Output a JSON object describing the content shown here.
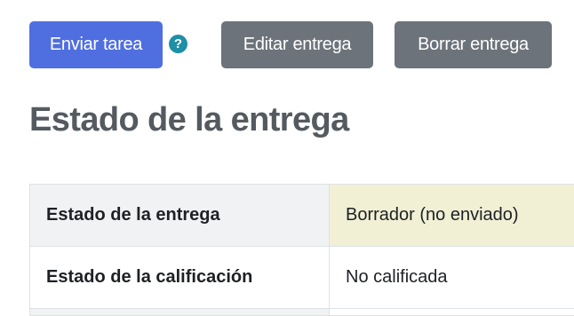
{
  "actions": {
    "submit_label": "Enviar tarea",
    "edit_label": "Editar entrega",
    "delete_label": "Borrar entrega",
    "help_icon": "question-circle-icon",
    "help_glyph": "?",
    "colors": {
      "primary": "#4f6ee0",
      "secondary": "#6c737a",
      "help": "#1f8fa6"
    }
  },
  "heading": "Estado de la entrega",
  "status_table": {
    "rows": [
      {
        "label": "Estado de la entrega",
        "value": "Borrador (no enviado)",
        "highlight": "#f1f0d4"
      },
      {
        "label": "Estado de la calificación",
        "value": "No calificada"
      }
    ]
  }
}
